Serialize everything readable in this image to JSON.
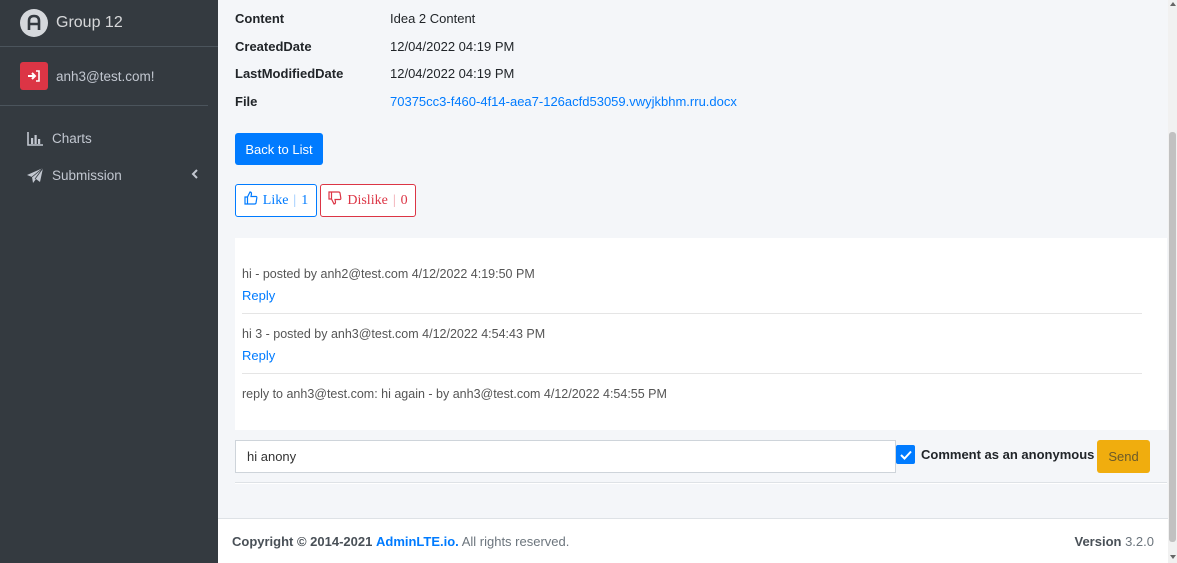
{
  "brand": {
    "title": "Group 12",
    "icon": "adminlte-logo-icon"
  },
  "user": {
    "name": "anh3@test.com!",
    "icon": "sign-out-icon",
    "color": "#dc3545"
  },
  "nav": {
    "items": [
      {
        "label": "Charts",
        "icon": "bar-chart-icon"
      },
      {
        "label": "Submission",
        "icon": "paper-plane-icon"
      }
    ]
  },
  "details": {
    "content_label": "Content",
    "content_value": "Idea 2 Content",
    "created_label": "CreatedDate",
    "created_value": "12/04/2022 04:19 PM",
    "modified_label": "LastModifiedDate",
    "modified_value": "12/04/2022 04:19 PM",
    "file_label": "File",
    "file_value": "70375cc3-f460-4f14-aea7-126acfd53059.vwyjkbhm.rru.docx"
  },
  "actions": {
    "back_label": "Back to List"
  },
  "votes": {
    "like_label": "Like",
    "like_sep": "|",
    "like_count": "1",
    "dislike_label": "Dislike",
    "dislike_sep": "|",
    "dislike_count": "0"
  },
  "comments": [
    {
      "text": "hi - posted by anh2@test.com 4/12/2022 4:19:50 PM",
      "reply_label": "Reply"
    },
    {
      "text": "hi 3 - posted by anh3@test.com 4/12/2022 4:54:43 PM",
      "reply_label": "Reply"
    },
    {
      "text": "reply to anh3@test.com: hi again - by anh3@test.com 4/12/2022 4:54:55 PM"
    }
  ],
  "comment_form": {
    "input_value": "hi anony",
    "anonymous_label": "Comment as an anonymous ?",
    "anonymous_checked": true,
    "send_label": "Send"
  },
  "footer": {
    "copyright_prefix": "Copyright © 2014-2021",
    "brand_link": "AdminLTE.io.",
    "rights": "All rights reserved.",
    "version_label": "Version",
    "version_value": "3.2.0"
  },
  "colors": {
    "primary": "#007bff",
    "danger": "#dc3545",
    "warning": "#f0ad0e",
    "sidebar": "#343a40"
  }
}
